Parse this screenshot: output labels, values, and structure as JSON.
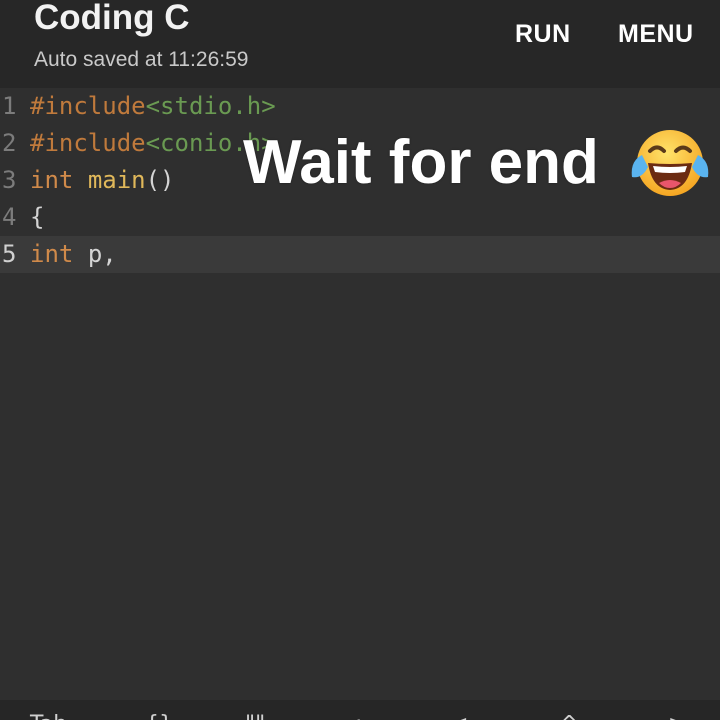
{
  "app": {
    "title": "Coding C",
    "subtitle": "Auto saved at 11:26:59",
    "run_label": "RUN",
    "menu_label": "MENU"
  },
  "editor": {
    "lines": [
      {
        "num": "1",
        "active": false
      },
      {
        "num": "2",
        "active": false
      },
      {
        "num": "3",
        "active": false
      },
      {
        "num": "4",
        "active": false
      },
      {
        "num": "5",
        "active": true
      }
    ],
    "tokens": {
      "l1_directive": "#include",
      "l1_header": "<stdio.h>",
      "l2_directive": "#include",
      "l2_header": "<conio.h>",
      "l3_type": "int",
      "l3_name": "main",
      "l3_parens": "()",
      "l4_brace": "{",
      "l5_type": "int",
      "l5_rest": "p,"
    }
  },
  "overlay": {
    "caption": "Wait for end",
    "emoji_icon": "face-with-tears-of-joy-icon"
  },
  "keybar": {
    "keys": [
      "Tab",
      "{}",
      "\"\"",
      ";",
      "<",
      "^",
      ">"
    ]
  },
  "colors": {
    "appbar_bg": "#272727",
    "editor_bg": "#2f2f2f",
    "active_line_bg": "#3a3a3a",
    "keyword": "#d08a4a",
    "string": "#6a9a52",
    "function": "#e0b85a",
    "plain": "#d4d4d4"
  }
}
